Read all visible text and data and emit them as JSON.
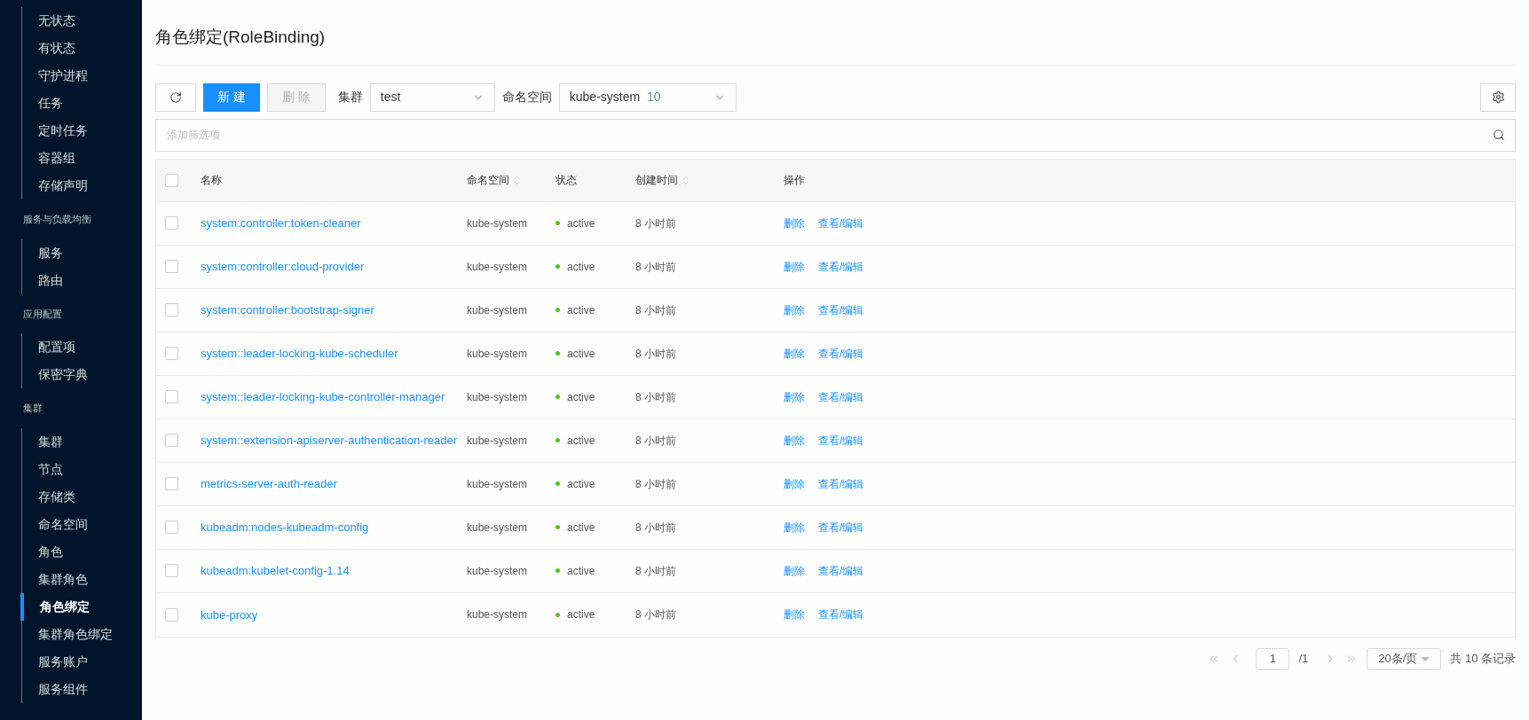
{
  "sidebar": {
    "groups": [
      {
        "items": [
          {
            "label": "无状态",
            "selected": false
          },
          {
            "label": "有状态",
            "selected": false
          },
          {
            "label": "守护进程",
            "selected": false
          },
          {
            "label": "任务",
            "selected": false
          },
          {
            "label": "定时任务",
            "selected": false
          },
          {
            "label": "容器组",
            "selected": false
          },
          {
            "label": "存储声明",
            "selected": false
          }
        ]
      },
      {
        "heading": "服务与负载均衡",
        "items": [
          {
            "label": "服务",
            "selected": false
          },
          {
            "label": "路由",
            "selected": false
          }
        ]
      },
      {
        "heading": "应用配置",
        "items": [
          {
            "label": "配置项",
            "selected": false
          },
          {
            "label": "保密字典",
            "selected": false
          }
        ]
      },
      {
        "heading": "集群",
        "items": [
          {
            "label": "集群",
            "selected": false
          },
          {
            "label": "节点",
            "selected": false
          },
          {
            "label": "存储类",
            "selected": false
          },
          {
            "label": "命名空间",
            "selected": false
          },
          {
            "label": "角色",
            "selected": false
          },
          {
            "label": "集群角色",
            "selected": false
          },
          {
            "label": "角色绑定",
            "selected": true
          },
          {
            "label": "集群角色绑定",
            "selected": false
          },
          {
            "label": "服务账户",
            "selected": false
          },
          {
            "label": "服务组件",
            "selected": false
          }
        ]
      }
    ]
  },
  "page_title": "角色绑定(RoleBinding)",
  "toolbar": {
    "new_button": "新 建",
    "delete_button": {
      "label": "删 除",
      "disabled": true
    },
    "cluster_label": "集群",
    "cluster_value": "test",
    "namespace_label": "命名空间",
    "namespace_value": "kube-system",
    "namespace_count": "10"
  },
  "filter": {
    "placeholder": "添加筛选项"
  },
  "table": {
    "select_all_checked": false,
    "columns": [
      {
        "label": "名称",
        "sortable": false
      },
      {
        "label": "命名空间",
        "sortable": true
      },
      {
        "label": "状态",
        "sortable": false
      },
      {
        "label": "创建时间",
        "sortable": true
      },
      {
        "label": "操作",
        "sortable": false
      }
    ],
    "rows": [
      {
        "name": "system:controller:token-cleaner",
        "namespace": "kube-system",
        "status": "active",
        "created": "8 小时前",
        "actions": [
          "删除",
          "查看/编辑"
        ],
        "checked": false
      },
      {
        "name": "system:controller:cloud-provider",
        "namespace": "kube-system",
        "status": "active",
        "created": "8 小时前",
        "actions": [
          "删除",
          "查看/编辑"
        ],
        "checked": false
      },
      {
        "name": "system:controller:bootstrap-signer",
        "namespace": "kube-system",
        "status": "active",
        "created": "8 小时前",
        "actions": [
          "删除",
          "查看/编辑"
        ],
        "checked": false
      },
      {
        "name": "system::leader-locking-kube-scheduler",
        "namespace": "kube-system",
        "status": "active",
        "created": "8 小时前",
        "actions": [
          "删除",
          "查看/编辑"
        ],
        "checked": false
      },
      {
        "name": "system::leader-locking-kube-controller-manager",
        "namespace": "kube-system",
        "status": "active",
        "created": "8 小时前",
        "actions": [
          "删除",
          "查看/编辑"
        ],
        "checked": false
      },
      {
        "name": "system::extension-apiserver-authentication-reader",
        "namespace": "kube-system",
        "status": "active",
        "created": "8 小时前",
        "actions": [
          "删除",
          "查看/编辑"
        ],
        "checked": false
      },
      {
        "name": "metrics-server-auth-reader",
        "namespace": "kube-system",
        "status": "active",
        "created": "8 小时前",
        "actions": [
          "删除",
          "查看/编辑"
        ],
        "checked": false
      },
      {
        "name": "kubeadm:nodes-kubeadm-config",
        "namespace": "kube-system",
        "status": "active",
        "created": "8 小时前",
        "actions": [
          "删除",
          "查看/编辑"
        ],
        "checked": false
      },
      {
        "name": "kubeadm:kubelet-config-1.14",
        "namespace": "kube-system",
        "status": "active",
        "created": "8 小时前",
        "actions": [
          "删除",
          "查看/编辑"
        ],
        "checked": false
      },
      {
        "name": "kube-proxy",
        "namespace": "kube-system",
        "status": "active",
        "created": "8 小时前",
        "actions": [
          "删除",
          "查看/编辑"
        ],
        "checked": false
      }
    ]
  },
  "pagination": {
    "page": "1",
    "total_pages": "/1",
    "page_size": "20条/页",
    "total": "共 10 条记录"
  }
}
